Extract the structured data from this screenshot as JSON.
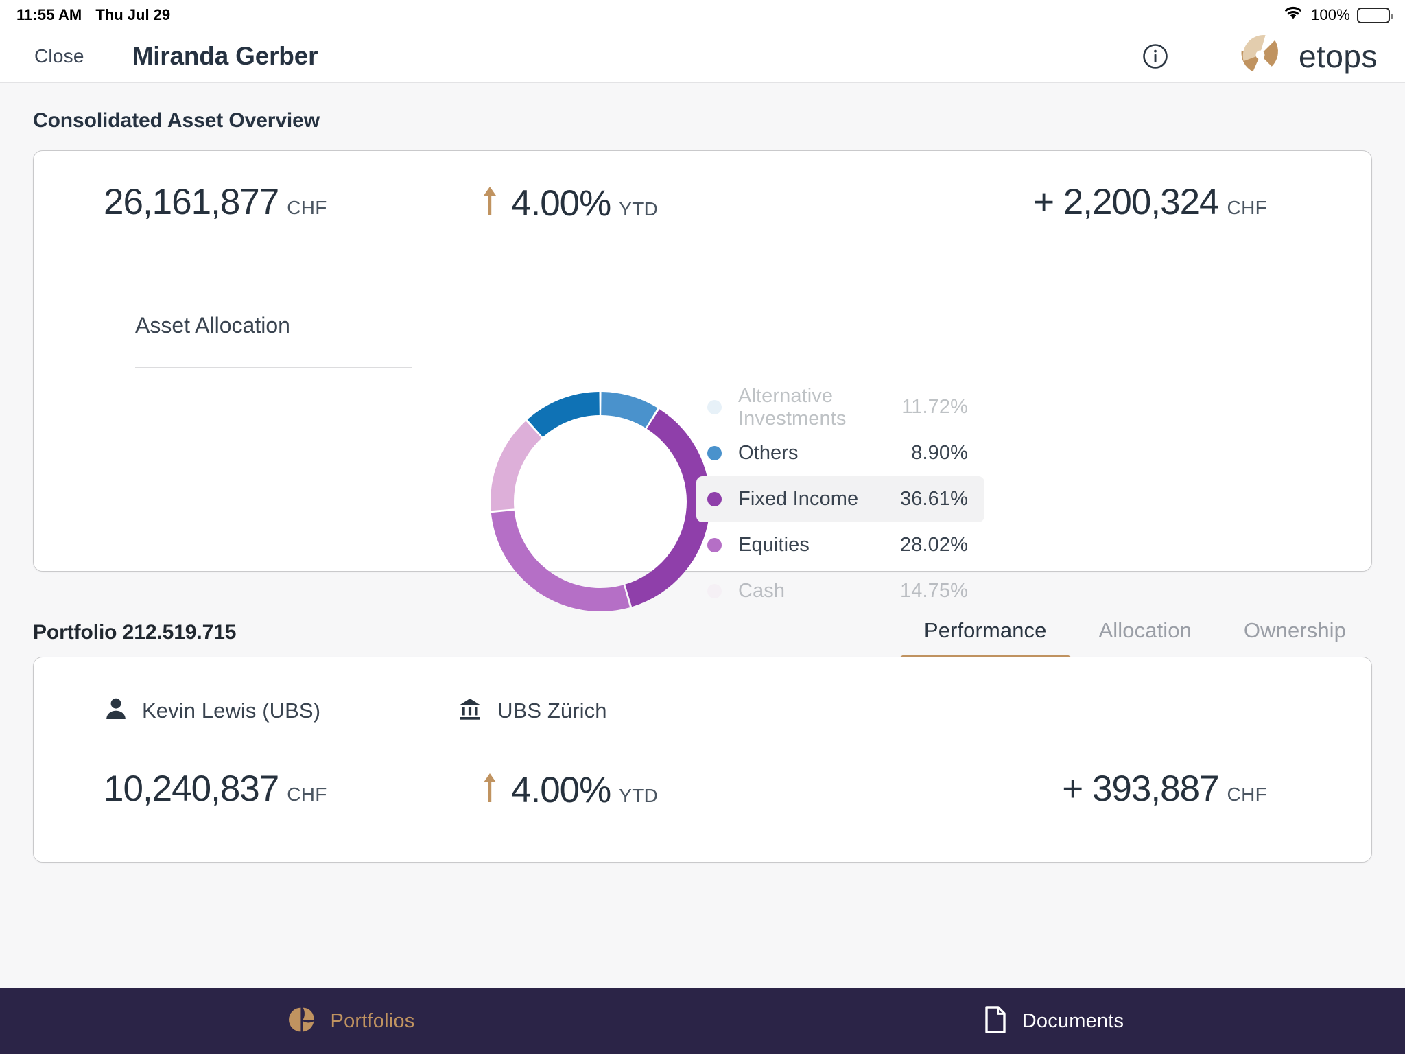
{
  "status_bar": {
    "time": "11:55 AM",
    "date": "Thu Jul 29",
    "battery_percent": "100%",
    "wifi_icon": "wifi-icon",
    "battery_icon": "battery-icon"
  },
  "header": {
    "close_label": "Close",
    "title": "Miranda Gerber",
    "info_icon": "info-circle-icon",
    "brand_name": "etops",
    "brand_logo_icon": "etops-pinwheel-logo-icon",
    "brand_color": "#c09360"
  },
  "overview": {
    "section_title": "Consolidated Asset Overview",
    "total_value": "26,161,877",
    "total_currency": "CHF",
    "performance_value": "4.00%",
    "performance_period": "YTD",
    "performance_direction": "up",
    "performance_arrow_color": "#c09360",
    "absolute_change": "+ 2,200,324",
    "absolute_currency": "CHF",
    "allocation_label": "Asset Allocation"
  },
  "chart_data": {
    "type": "pie",
    "title": "Asset Allocation",
    "subtitle": "",
    "xlabel": "",
    "ylabel": "",
    "legend_position": "right",
    "donut": true,
    "inner_radius_ratio": 0.78,
    "start_angle_deg": 0,
    "categories": [
      "Others",
      "Fixed Income",
      "Equities",
      "Cash",
      "Alternative Investments"
    ],
    "values": [
      8.9,
      36.61,
      28.02,
      14.75,
      11.72
    ],
    "colors": [
      "#4a92cc",
      "#8f3faa",
      "#b56fc6",
      "#ddafd9",
      "#0f72b5"
    ],
    "value_labels": [
      "8.90%",
      "36.61%",
      "28.02%",
      "14.75%",
      "11.72%"
    ],
    "legend_items": [
      {
        "label": "Alternative Investments",
        "percent": "11.72%",
        "color": "#b5d4ec",
        "state": "faded"
      },
      {
        "label": "Others",
        "percent": "8.90%",
        "color": "#4a92cc",
        "state": "normal"
      },
      {
        "label": "Fixed Income",
        "percent": "36.61%",
        "color": "#8f3faa",
        "state": "active"
      },
      {
        "label": "Equities",
        "percent": "28.02%",
        "color": "#b56fc6",
        "state": "normal"
      },
      {
        "label": "Cash",
        "percent": "14.75%",
        "color": "#f3e2f0",
        "state": "faded"
      }
    ]
  },
  "portfolio": {
    "name": "Portfolio 212.519.715",
    "tabs": [
      {
        "label": "Performance",
        "active": true
      },
      {
        "label": "Allocation",
        "active": false
      },
      {
        "label": "Ownership",
        "active": false
      }
    ],
    "advisor_name": "Kevin Lewis (UBS)",
    "advisor_icon": "person-icon",
    "bank_name": "UBS Zürich",
    "bank_icon": "bank-icon",
    "total_value": "10,240,837",
    "total_currency": "CHF",
    "performance_value": "4.00%",
    "performance_period": "YTD",
    "absolute_change": "+ 393,887",
    "absolute_currency": "CHF"
  },
  "tab_bar": {
    "background": "#2b2447",
    "items": [
      {
        "label": "Portfolios",
        "icon": "portfolios-pie-icon",
        "active": true
      },
      {
        "label": "Documents",
        "icon": "document-icon",
        "active": false
      }
    ]
  }
}
